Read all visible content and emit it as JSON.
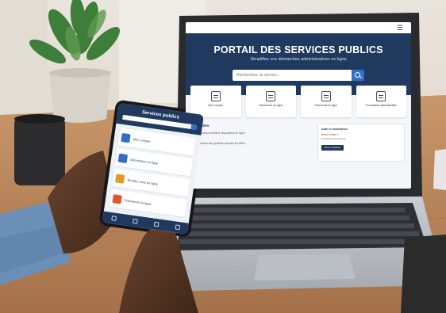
{
  "laptop_screen": {
    "title": "PORTAIL DES SERVICES PUBLICS",
    "subtitle": "Simplifiez vos démarches administratives en ligne",
    "search_placeholder": "Recherchez un service...",
    "service_cards": [
      {
        "label": "Mon compte",
        "icon": "id-card-icon"
      },
      {
        "label": "Démarches en ligne",
        "icon": "document-icon"
      },
      {
        "label": "Paiements en ligne",
        "icon": "payment-card-icon"
      },
      {
        "label": "Formulaires administratifs",
        "icon": "form-edit-icon"
      }
    ],
    "news_heading": "Actualités",
    "news_items": [
      "Nouveaux services disponibles en ligne",
      "Horaires des guichets pendant les fêtes"
    ],
    "side_panel": {
      "heading": "Aide et assistance",
      "highlight": "Besoin d'aide ?",
      "text": "Contactez nos services",
      "button": "Nous contacter"
    }
  },
  "phone_screen": {
    "title": "Services publics",
    "items": [
      {
        "label": "Mon compte",
        "color": "#2f6fc6"
      },
      {
        "label": "Démarches en ligne",
        "color": "#2f6fc6"
      },
      {
        "label": "Rendez-vous en ligne",
        "color": "#e39a2b"
      },
      {
        "label": "Paiements en ligne",
        "color": "#e0562e"
      }
    ]
  },
  "colors": {
    "brand_navy": "#1f3a5e",
    "accent_blue": "#2f6fc6",
    "desk_wood": "#b9865a"
  }
}
